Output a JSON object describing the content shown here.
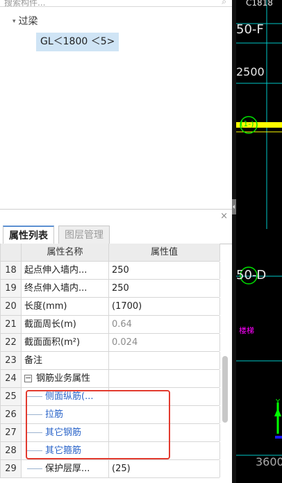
{
  "search": {
    "placeholder": "搜索构件..."
  },
  "tree": {
    "root_label": "过梁",
    "child_label": "GL＜1800 ＜5>"
  },
  "props": {
    "tabs": [
      {
        "label": "属性列表"
      },
      {
        "label": "图层管理"
      }
    ],
    "columns": {
      "name": "属性名称",
      "value": "属性值"
    },
    "rows": [
      {
        "num": "18",
        "name": "起点伸入墙内...",
        "value": "250"
      },
      {
        "num": "19",
        "name": "终点伸入墙内...",
        "value": "250"
      },
      {
        "num": "20",
        "name": "长度(mm)",
        "value": "(1700)"
      },
      {
        "num": "21",
        "name": "截面周长(m)",
        "value": "0.64"
      },
      {
        "num": "22",
        "name": "截面面积(m²)",
        "value": "0.024"
      },
      {
        "num": "23",
        "name": "备注",
        "value": ""
      },
      {
        "num": "24",
        "name": "钢筋业务属性",
        "value": "",
        "expander": "−"
      },
      {
        "num": "25",
        "name": "侧面纵筋(...",
        "value": ""
      },
      {
        "num": "26",
        "name": "拉筋",
        "value": ""
      },
      {
        "num": "27",
        "name": "其它钢筋",
        "value": ""
      },
      {
        "num": "28",
        "name": "其它箍筋",
        "value": ""
      },
      {
        "num": "29",
        "name": "保护层厚...",
        "value": "(25)"
      }
    ]
  },
  "cad": {
    "labels": {
      "top": "C1818",
      "f": "50-F",
      "dim1": "2500",
      "marker": "(1-)",
      "d": "50-D",
      "magenta": "楼梯",
      "y": "Y",
      "bottom": "3600"
    },
    "colors": {
      "background": "#000000",
      "grid_line": "#00c8c8",
      "yellow_line": "#ffff00",
      "marker": "#00e000",
      "magenta": "#ff00ff",
      "axis_y": "#00ff00",
      "axis_x": "#1a1aff"
    }
  },
  "colors": {
    "selected_bg": "#cfe4f5",
    "link_blue": "#2a64c9",
    "highlight_red": "#e23a2e"
  }
}
